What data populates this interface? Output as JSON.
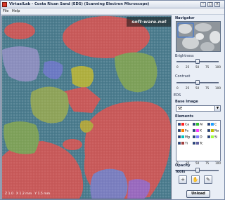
{
  "window": {
    "title": "VirtualLab - Costa Rican Sand (EDS) (Scanning Electron Microscope)",
    "controls": [
      "–",
      "□",
      "×"
    ]
  },
  "menu": {
    "items": [
      "File",
      "Help"
    ]
  },
  "viewer": {
    "watermark": "soft-ware.net",
    "status": [
      "Z 1.0",
      "X 1.2 mm",
      "Y 1.5 mm"
    ]
  },
  "panel": {
    "navigator_label": "Navigator",
    "brightness_label": "Brightness",
    "brightness_ticks": [
      "0",
      "25",
      "50",
      "75",
      "100"
    ],
    "brightness_value": 50,
    "contrast_label": "Contrast",
    "contrast_ticks": [
      "0",
      "25",
      "50",
      "75",
      "100"
    ],
    "contrast_value": 50,
    "eds_label": "EDS",
    "base_image_label": "Base Image",
    "base_image_value": "SE",
    "elements_label": "Elements",
    "elements": [
      {
        "symbol": "Ca",
        "color": "#ff2020",
        "checked": true
      },
      {
        "symbol": "Al",
        "color": "#30c030",
        "checked": true
      },
      {
        "symbol": "C",
        "color": "#20a0ff",
        "checked": true
      },
      {
        "symbol": "Fe",
        "color": "#ff8000",
        "checked": true
      },
      {
        "symbol": "K",
        "color": "#ff40ff",
        "checked": true
      },
      {
        "symbol": "Na",
        "color": "#c0c000",
        "checked": true
      },
      {
        "symbol": "Mg",
        "color": "#00c0c0",
        "checked": true
      },
      {
        "symbol": "O",
        "color": "#8080ff",
        "checked": true
      },
      {
        "symbol": "Si",
        "color": "#a0ff40",
        "checked": true
      },
      {
        "symbol": "Ti",
        "color": "#a04040",
        "checked": true
      },
      {
        "symbol": "Tc",
        "color": "#6060a0",
        "checked": true
      }
    ],
    "opacity_label": "Opacity",
    "opacity_ticks": [
      "0",
      "25",
      "50",
      "75",
      "100"
    ],
    "opacity_value": 50,
    "tools_label": "Tools",
    "tools": [
      "crosshair-icon",
      "hand-icon",
      "pencil-icon"
    ],
    "unload_label": "Unload"
  }
}
